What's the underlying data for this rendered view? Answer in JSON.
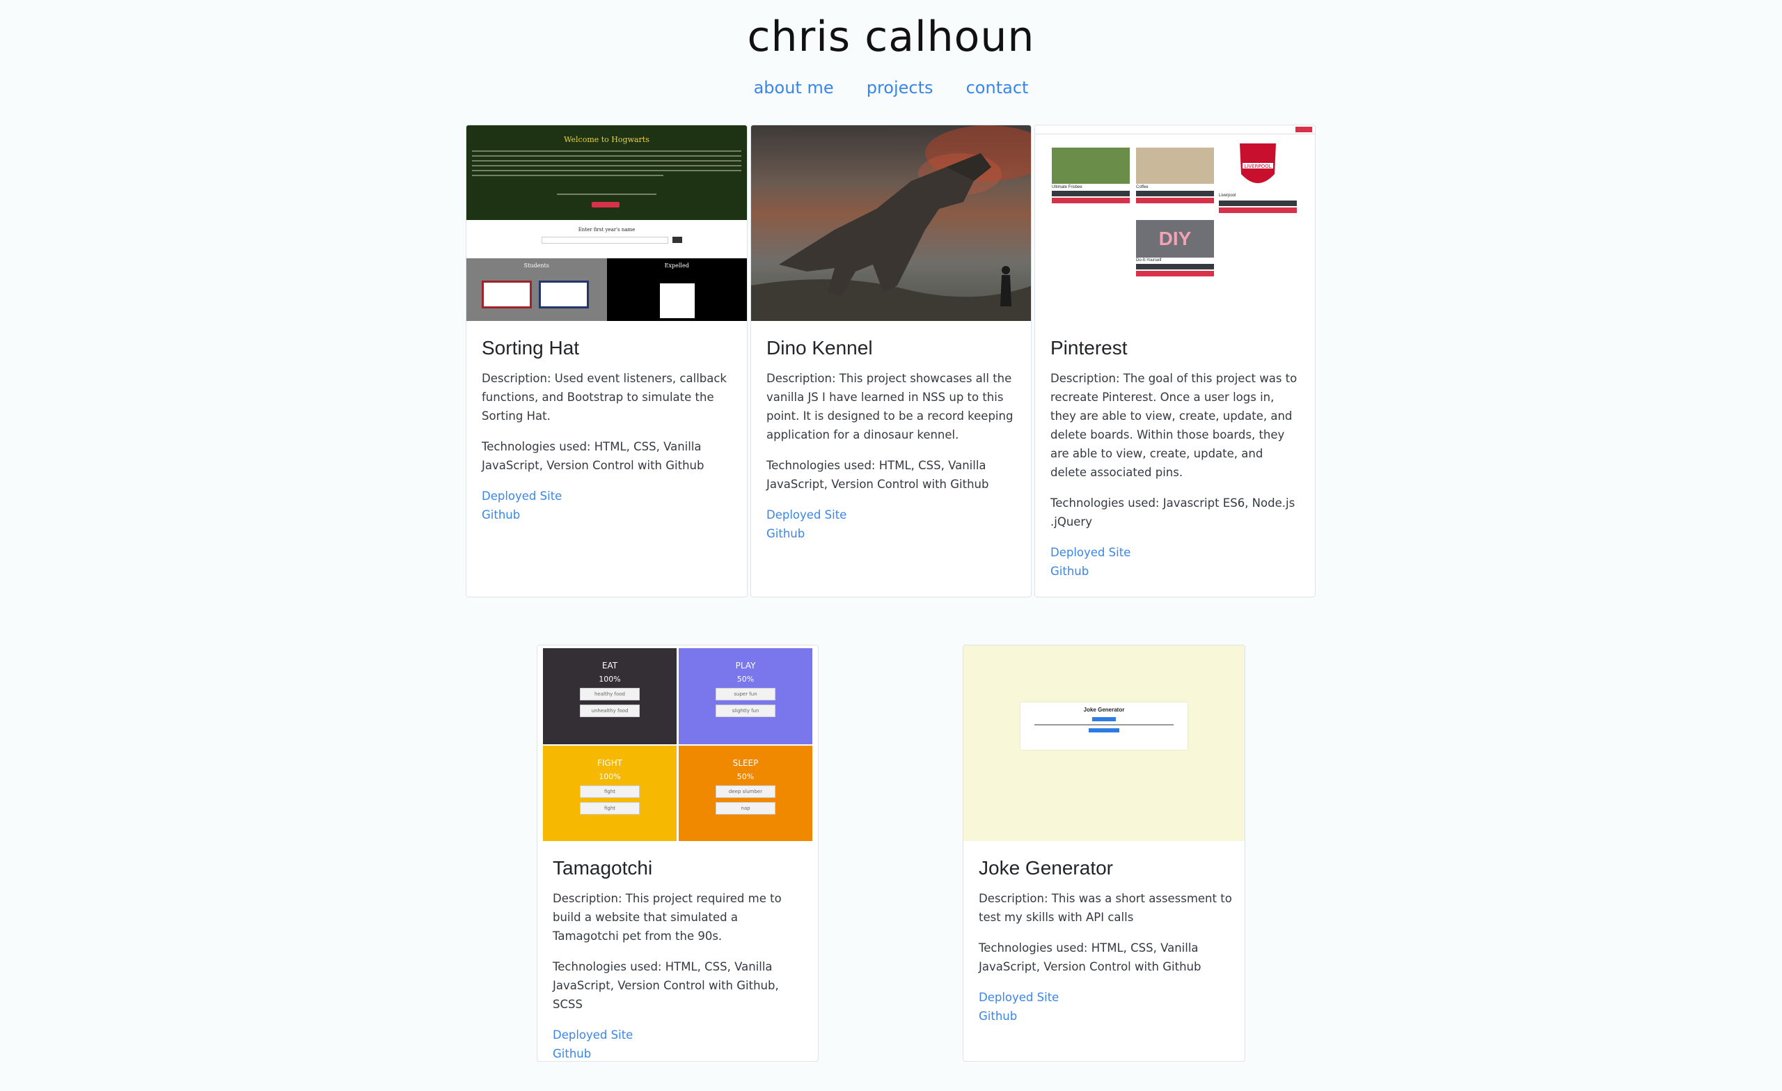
{
  "header": {
    "title": "chris calhoun",
    "nav": [
      "about me",
      "projects",
      "contact"
    ]
  },
  "projects": [
    {
      "title": "Sorting Hat",
      "description": "Description: Used event listeners, callback functions, and Bootstrap to simulate the Sorting Hat.",
      "technologies": "Technologies used: HTML, CSS, Vanilla JavaScript, Version Control with Github",
      "deployed_label": "Deployed Site",
      "github_label": "Github",
      "thumb": {
        "title": "Welcome to Hogwarts",
        "form_label": "Enter first year's name",
        "left_label": "Students",
        "right_label": "Expelled"
      }
    },
    {
      "title": "Dino Kennel",
      "description": "Description: This project showcases all the vanilla JS I have learned in NSS up to this point. It is designed to be a record keeping application for a dinosaur kennel.",
      "technologies": "Technologies used: HTML, CSS, Vanilla JavaScript, Version Control with Github",
      "deployed_label": "Deployed Site",
      "github_label": "Github"
    },
    {
      "title": "Pinterest",
      "description": "Description: The goal of this project was to recreate Pinterest. Once a user logs in, they are able to view, create, update, and delete boards. Within those boards, they are able to view, create, update, and delete associated pins.",
      "technologies": "Technologies used: Javascript ES6, Node.js .jQuery",
      "deployed_label": "Deployed Site",
      "github_label": "Github",
      "thumb": {
        "boards": [
          "Ultimate Frisbee",
          "Coffee",
          "Liverpool",
          "Do-It-Yourself"
        ],
        "badge": "LIVERPOOL",
        "diy": "DIY"
      }
    },
    {
      "title": "Tamagotchi",
      "description": "Description: This project required me to build a website that simulated a Tamagotchi pet from the 90s.",
      "technologies": "Technologies used: HTML, CSS, Vanilla JavaScript, Version Control with Github, SCSS",
      "deployed_label": "Deployed Site",
      "github_label": "Github",
      "thumb": {
        "quadrants": [
          {
            "label": "EAT",
            "pct": "100%",
            "buttons": [
              "healthy food",
              "unhealthy food"
            ],
            "color": "#332f35"
          },
          {
            "label": "PLAY",
            "pct": "50%",
            "buttons": [
              "super fun",
              "slightly fun"
            ],
            "color": "#7a76ec"
          },
          {
            "label": "FIGHT",
            "pct": "100%",
            "buttons": [
              "fight",
              "fight"
            ],
            "color": "#f6b800"
          },
          {
            "label": "SLEEP",
            "pct": "50%",
            "buttons": [
              "deep slumber",
              "nap"
            ],
            "color": "#f08800"
          }
        ]
      }
    },
    {
      "title": "Joke Generator",
      "description": "Description: This was a short assessment to test my skills with API calls",
      "technologies": "Technologies used: HTML, CSS, Vanilla JavaScript, Version Control with Github",
      "deployed_label": "Deployed Site",
      "github_label": "Github",
      "thumb": {
        "heading": "Joke Generator"
      }
    }
  ],
  "colors": {
    "link": "#3a86e8",
    "background": "#f8fcfc",
    "card_border": "#dfe2e6"
  }
}
